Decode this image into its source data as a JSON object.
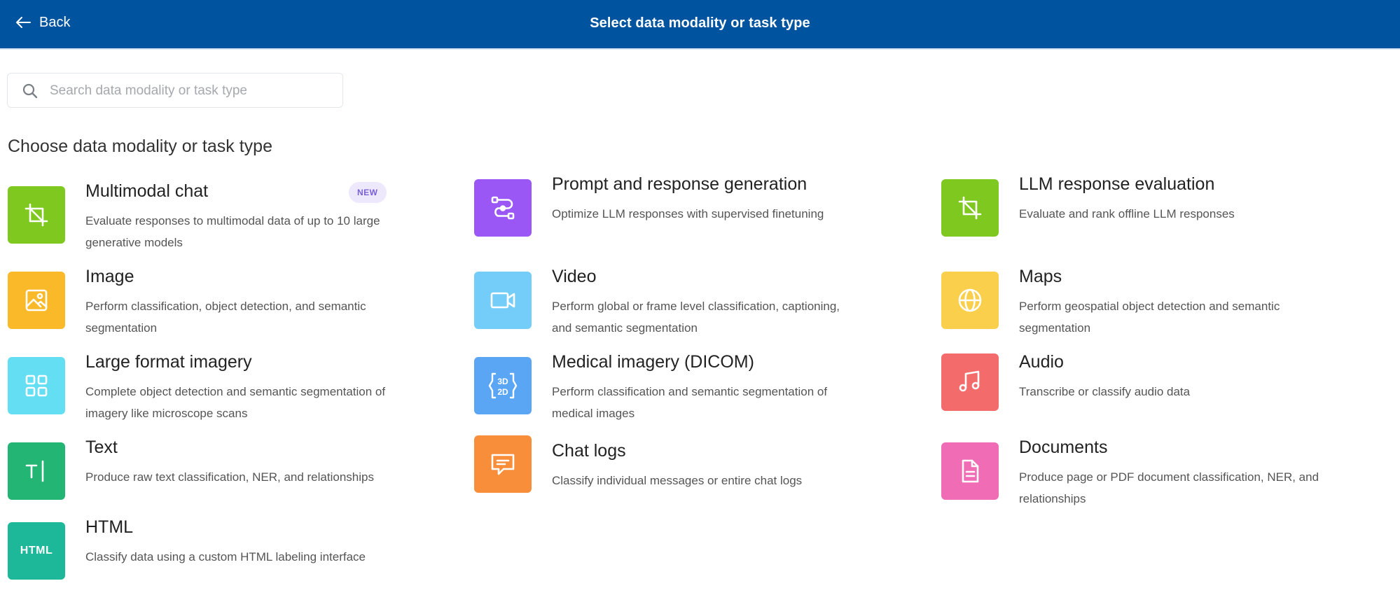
{
  "header": {
    "back_label": "Back",
    "title": "Select data modality or task type"
  },
  "search": {
    "placeholder": "Search data modality or task type",
    "value": ""
  },
  "section": {
    "heading": "Choose data modality or task type"
  },
  "cards": [
    {
      "title": "Multimodal chat",
      "description": "Evaluate responses to multimodal data of up to 10 large generative models",
      "badge": "NEW",
      "icon": "crop-frame-icon",
      "color": "#7ec820"
    },
    {
      "title": "Prompt and response generation",
      "description": "Optimize LLM responses with supervised finetuning",
      "icon": "prompt-flow-icon",
      "color": "#9b57f5"
    },
    {
      "title": "LLM response evaluation",
      "description": "Evaluate and rank offline LLM responses",
      "icon": "crop-frame-icon",
      "color": "#7ec820"
    },
    {
      "title": "Image",
      "description": "Perform classification, object detection, and semantic segmentation",
      "icon": "image-icon",
      "color": "#f9b928"
    },
    {
      "title": "Video",
      "description": "Perform global or frame level classification, captioning, and semantic segmentation",
      "icon": "video-camera-icon",
      "color": "#74cdf8"
    },
    {
      "title": "Maps",
      "description": "Perform geospatial object detection and semantic segmentation",
      "icon": "globe-icon",
      "color": "#f9cf4b"
    },
    {
      "title": "Large format imagery",
      "description": "Complete object detection and semantic segmentation of imagery like microscope scans",
      "icon": "grid-tiles-icon",
      "color": "#63def2"
    },
    {
      "title": "Medical imagery (DICOM)",
      "description": "Perform classification and semantic segmentation of medical images",
      "icon": "3d-2d-icon",
      "color": "#5aa6f5"
    },
    {
      "title": "Audio",
      "description": "Transcribe or classify audio data",
      "icon": "music-note-icon",
      "color": "#f36b6b"
    },
    {
      "title": "Text",
      "description": "Produce raw text classification, NER, and relationships",
      "icon": "text-cursor-icon",
      "color": "#22b573"
    },
    {
      "title": "Chat logs",
      "description": "Classify individual messages or entire chat logs",
      "icon": "chat-bubble-icon",
      "color": "#f98e3a"
    },
    {
      "title": "Documents",
      "description": "Produce page or PDF document classification, NER, and relationships",
      "icon": "document-icon",
      "color": "#f06cb4"
    },
    {
      "title": "HTML",
      "description": "Classify data using a custom HTML labeling interface",
      "icon_text": "HTML",
      "icon": "html-icon",
      "color": "#1db89a"
    }
  ]
}
